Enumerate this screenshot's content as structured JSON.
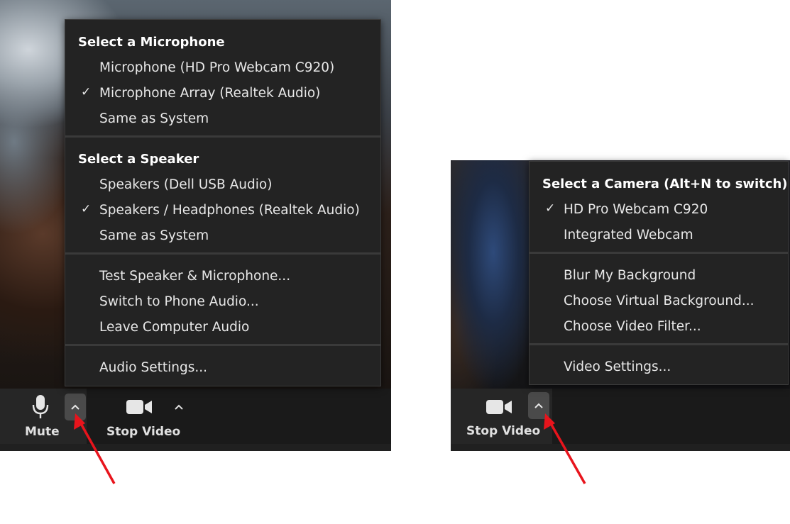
{
  "audio_menu": {
    "microphone_heading": "Select a Microphone",
    "microphones": [
      {
        "label": "Microphone (HD Pro Webcam C920)",
        "checked": false
      },
      {
        "label": "Microphone Array (Realtek Audio)",
        "checked": true
      },
      {
        "label": "Same as System",
        "checked": false
      }
    ],
    "speaker_heading": "Select a Speaker",
    "speakers": [
      {
        "label": "Speakers (Dell USB Audio)",
        "checked": false
      },
      {
        "label": "Speakers / Headphones (Realtek Audio)",
        "checked": true
      },
      {
        "label": "Same as System",
        "checked": false
      }
    ],
    "actions": [
      {
        "label": "Test Speaker & Microphone..."
      },
      {
        "label": "Switch to Phone Audio..."
      },
      {
        "label": "Leave Computer Audio"
      }
    ],
    "settings_label": "Audio Settings..."
  },
  "video_menu": {
    "camera_heading": "Select a Camera (Alt+N to switch)",
    "cameras": [
      {
        "label": "HD Pro Webcam C920",
        "checked": true
      },
      {
        "label": "Integrated Webcam",
        "checked": false
      }
    ],
    "actions": [
      {
        "label": "Blur My Background"
      },
      {
        "label": "Choose Virtual Background..."
      },
      {
        "label": "Choose Video Filter..."
      }
    ],
    "settings_label": "Video Settings..."
  },
  "toolbar_left": {
    "mute_label": "Mute",
    "stop_video_label": "Stop Video"
  },
  "toolbar_right": {
    "stop_video_label": "Stop Video"
  },
  "check_glyph": "✓",
  "caret_glyph": "^",
  "colors": {
    "menu_background": "#232323",
    "menu_text": "#e8e8e8",
    "toolbar_background": "#1a1a1a",
    "active_caret_background": "#4a4a4a",
    "annotation_arrow": "#e8141c"
  }
}
